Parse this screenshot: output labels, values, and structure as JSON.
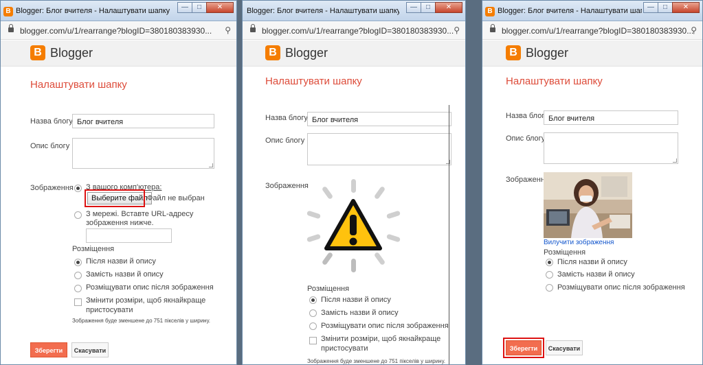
{
  "window": {
    "title": "Blogger: Блог вчителя - Налаштувати шапку - Go...",
    "url": "blogger.com/u/1/rearrange?blogID=380180383930...",
    "brand": "Blogger"
  },
  "dialog": {
    "title": "Налаштувати шапку",
    "blog_name_label": "Назва блогу",
    "blog_name_value": "Блог вчителя",
    "blog_desc_label": "Опис блогу",
    "image_label": "Зображення",
    "from_computer": "З вашого комп'ютера:",
    "choose_file": "Выберите файл",
    "no_file": "Файл не выбран",
    "from_web_line1": "З мережі. Вставте URL-адресу",
    "from_web_line2": "зображення нижче.",
    "placement_label": "Розміщення",
    "opt_after": "Після назви й опису",
    "opt_instead": "Замість назви й опису",
    "opt_desc_after_image": "Розміщувати опис після зображення",
    "resize_line1": "Змінити розміри, щоб якнайкраще",
    "resize_line2": "пристосувати",
    "resize_note": "Зображення буде зменшене до 751 пікселів у ширину.",
    "remove_image": "Вилучити зображення",
    "save": "Зберегти",
    "cancel": "Скасувати"
  },
  "colors": {
    "accent": "#dd4b39",
    "brand": "#f57d00",
    "save_button": "#f26d4f",
    "highlight_box": "#dd1111",
    "link": "#1155cc"
  }
}
